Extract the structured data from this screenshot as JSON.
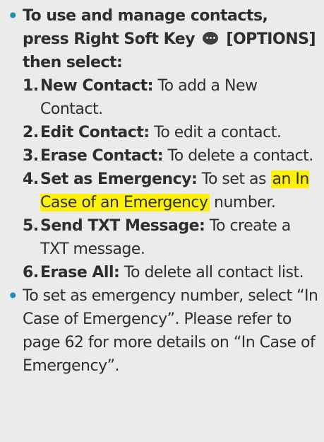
{
  "bullet1": {
    "text_before": "To use and manage contacts, press Right Soft Key",
    "icon": "options-soft-key-icon",
    "text_after": "[OPTIONS] then select:"
  },
  "steps": [
    {
      "num": "1.",
      "label": "New Contact:",
      "text": "To add a New Contact."
    },
    {
      "num": "2.",
      "label": "Edit Contact:",
      "text": "To edit a contact."
    },
    {
      "num": "3.",
      "label": "Erase Contact:",
      "text": "To delete a contact."
    },
    {
      "num": "4.",
      "label": "Set as Emergency:",
      "text_before": "To set as",
      "highlight": "an In Case of an Emergency",
      "text_after": "number."
    },
    {
      "num": "5.",
      "label": "Send TXT Message:",
      "text": "To create a TXT message."
    },
    {
      "num": "6.",
      "label": "Erase All:",
      "text": "To delete all contact list."
    }
  ],
  "bullet2": {
    "text": "To set as emergency number, select “In Case of Emergency”. Please refer to page 62 for more details on “In Case of Emergency”."
  },
  "colors": {
    "bullet": "#1e8fb4",
    "highlight": "#fff200",
    "background": "#ebebeb",
    "text": "#2e2e2e"
  }
}
